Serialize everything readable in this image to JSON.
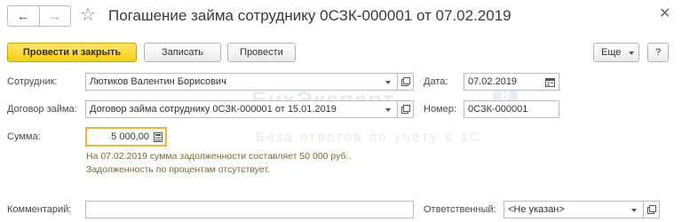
{
  "title": "Погашение займа сотруднику 0СЗК-000001 от 07.02.2019",
  "toolbar": {
    "post_close": "Провести и закрыть",
    "save": "Записать",
    "post": "Провести",
    "more": "Еще",
    "help": "?"
  },
  "form": {
    "employee_label": "Сотрудник:",
    "employee_value": "Лютиков Валентин Борисович",
    "date_label": "Дата:",
    "date_value": "07.02.2019",
    "contract_label": "Договор займа:",
    "contract_value": "Договор займа сотруднику 0СЗК-000001 от 15.01.2019",
    "number_label": "Номер:",
    "number_value": "0СЗК-000001",
    "amount_label": "Сумма:",
    "amount_value": "5 000,00",
    "info_line1": "На 07.02.2019 сумма задолженности составляет 50 000 руб..",
    "info_line2": "Задолженность по процентам отсутствует.",
    "comment_label": "Комментарий:",
    "comment_value": "",
    "responsible_label": "Ответственный:",
    "responsible_value": "<Не указан>"
  },
  "watermark": {
    "main": "БухЭксперт",
    "badge": "8",
    "sub": "База ответов по учёту в 1С"
  },
  "icons": {
    "back": "arrow-left-icon",
    "forward": "arrow-right-icon",
    "favorite": "star-icon",
    "close": "close-icon",
    "calendar": "calendar-icon",
    "calculator": "calculator-icon",
    "open": "open-form-icon",
    "dropdown": "chevron-down-icon"
  },
  "colors": {
    "primary_button": "#f5cf10",
    "amount_border": "#f0b43c",
    "info_text": "#7a6a3a"
  }
}
